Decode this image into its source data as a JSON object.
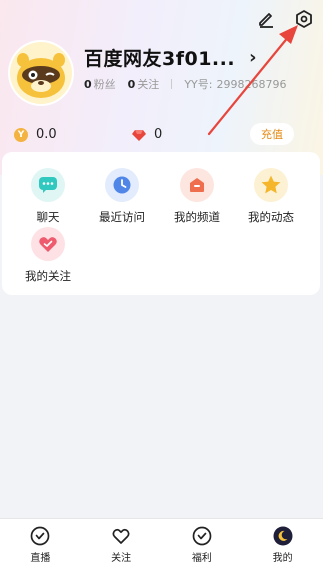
{
  "profile": {
    "nickname": "百度网友3f01...",
    "fans_count": "0",
    "fans_label": "粉丝",
    "follow_count": "0",
    "follow_label": "关注",
    "yy_label": "YY号:",
    "yy_number": "2998268796"
  },
  "wallet": {
    "coin_value": "0.0",
    "gem_value": "0",
    "recharge_label": "充值"
  },
  "grid": [
    {
      "label": "聊天",
      "icon": "chat-icon",
      "color": "#31c8c0"
    },
    {
      "label": "最近访问",
      "icon": "clock-icon",
      "color": "#4f86e8"
    },
    {
      "label": "我的频道",
      "icon": "channel-icon",
      "color": "#ee6e4e"
    },
    {
      "label": "我的动态",
      "icon": "star-icon",
      "color": "#f5b62b"
    },
    {
      "label": "我的关注",
      "icon": "heart-icon",
      "color": "#ee5b6e"
    }
  ],
  "tabs": [
    {
      "label": "直播",
      "icon": "live-icon"
    },
    {
      "label": "关注",
      "icon": "heart-outline-icon"
    },
    {
      "label": "福利",
      "icon": "welfare-icon"
    },
    {
      "label": "我的",
      "icon": "moon-avatar-icon"
    }
  ],
  "colors": {
    "accent_orange": "#e58a16",
    "annotation_red": "#e8453c"
  }
}
